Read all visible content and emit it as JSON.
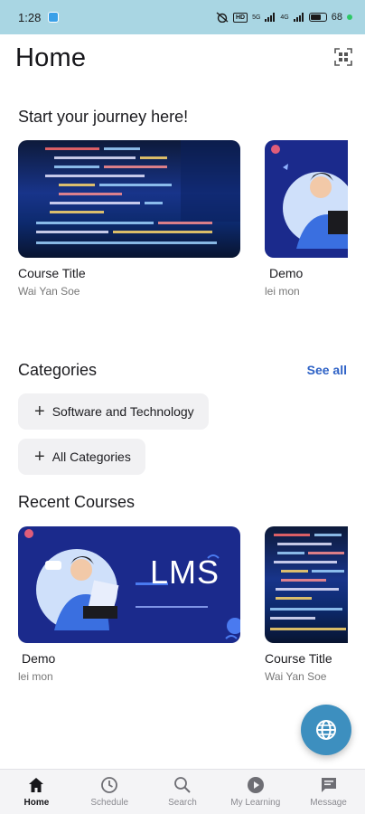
{
  "status_bar": {
    "time": "1:28",
    "hd_label": "HD",
    "signal1_label": "5G",
    "signal2_label": "4G",
    "battery": "68"
  },
  "header": {
    "title": "Home"
  },
  "journey": {
    "title": "Start your journey here!",
    "courses": [
      {
        "title": "Course Title",
        "author": "Wai Yan Soe"
      },
      {
        "title": "Demo",
        "author": "lei mon"
      }
    ]
  },
  "categories": {
    "title": "Categories",
    "see_all": "See all",
    "chips": [
      {
        "label": "Software and Technology"
      },
      {
        "label": "All Categories"
      }
    ]
  },
  "recent": {
    "title": "Recent Courses",
    "courses": [
      {
        "title": "Demo",
        "author": "lei mon",
        "thumb_text": "LMS"
      },
      {
        "title": "Course Title",
        "author": "Wai Yan Soe"
      }
    ]
  },
  "bottom_nav": {
    "items": [
      {
        "label": "Home",
        "icon": "home-icon"
      },
      {
        "label": "Schedule",
        "icon": "clock-icon"
      },
      {
        "label": "Search",
        "icon": "search-icon"
      },
      {
        "label": "My Learning",
        "icon": "play-circle-icon"
      },
      {
        "label": "Message",
        "icon": "chat-icon"
      }
    ]
  },
  "colors": {
    "accent": "#2e62c6",
    "fab": "#3d8fbf",
    "status_bar": "#a9d6e3"
  }
}
